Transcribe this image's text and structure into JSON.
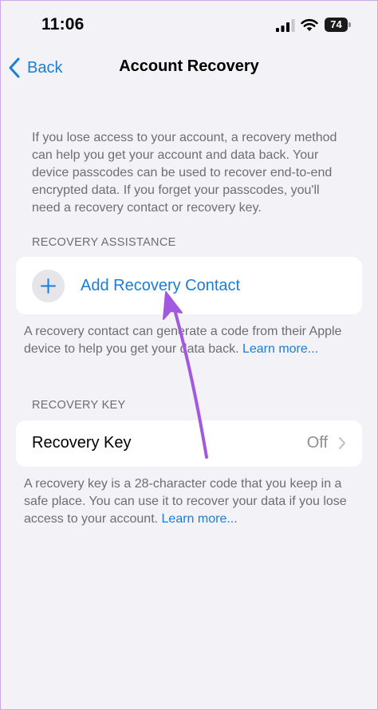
{
  "status_bar": {
    "time": "11:06",
    "battery_level": "74"
  },
  "nav": {
    "back_label": "Back",
    "title": "Account Recovery"
  },
  "intro": {
    "text": "If you lose access to your account, a recovery method can help you get your account and data back. Your device passcodes can be used to recover end-to-end encrypted data. If you forget your passcodes, you'll need a recovery contact or recovery key."
  },
  "recovery_assistance": {
    "header": "RECOVERY ASSISTANCE",
    "add_contact_label": "Add Recovery Contact",
    "footnote": "A recovery contact can generate a code from their Apple device to help you get your data back. ",
    "learn_more": "Learn more..."
  },
  "recovery_key": {
    "header": "RECOVERY KEY",
    "row_label": "Recovery Key",
    "row_value": "Off",
    "footnote": "A recovery key is a 28-character code that you keep in a safe place. You can use it to recover your data if you lose access to your account. ",
    "learn_more": "Learn more..."
  },
  "colors": {
    "accent": "#1a7ed8",
    "background": "#f2f2f7",
    "secondary_text": "#6d6d72",
    "annotation_arrow": "#a259e0"
  },
  "icons": {
    "signal": "cellular-signal-icon",
    "wifi": "wifi-icon",
    "back": "chevron-left-icon",
    "add": "plus-icon",
    "disclosure": "chevron-right-icon"
  }
}
